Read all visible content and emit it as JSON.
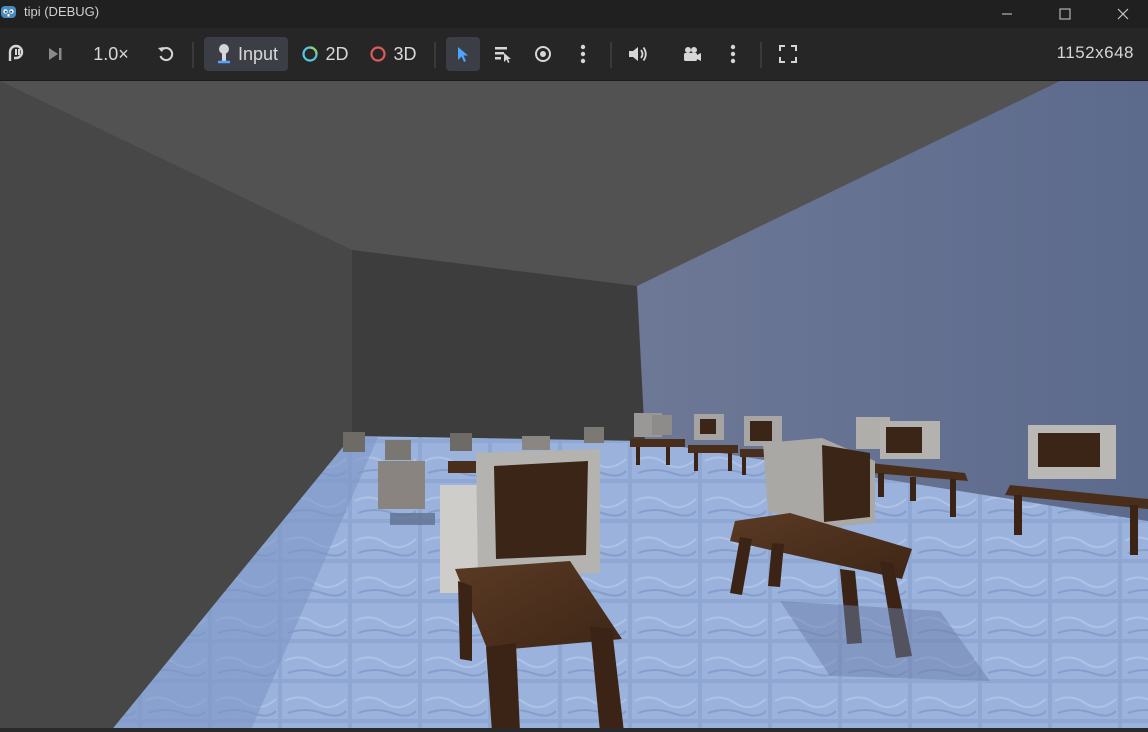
{
  "window": {
    "title": "tipi (DEBUG)",
    "icon": "godot-icon"
  },
  "toolbar": {
    "speed_label": "1.0×",
    "input_label": "Input",
    "mode_2d_label": "2D",
    "mode_3d_label": "3D",
    "resolution_label": "1152x648",
    "colors": {
      "active_bg": "#3b3e45",
      "accent_blue": "#4fa3ff",
      "ring_2d": "#57c7e0",
      "ring_3d": "#e05a5a"
    }
  },
  "scene": {
    "description_colors": {
      "left_wall": "#4a4a4a",
      "back_wall": "#3e3e3e",
      "right_wall": "#5f6d8c",
      "ceiling": "#525252",
      "floor": "#8aa3cf",
      "desk": "#4a2f1e",
      "monitor": "#9a9a9a",
      "screen": "#3b2517"
    }
  }
}
